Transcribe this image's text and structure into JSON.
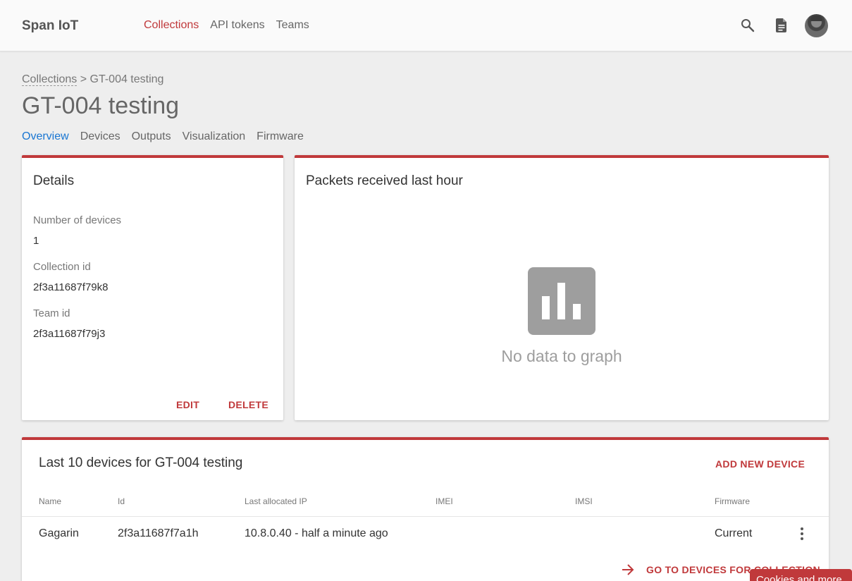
{
  "header": {
    "brand": "Span IoT",
    "nav": [
      {
        "label": "Collections",
        "active": true
      },
      {
        "label": "API tokens",
        "active": false
      },
      {
        "label": "Teams",
        "active": false
      }
    ],
    "icons": [
      "search-icon",
      "document-icon",
      "avatar"
    ]
  },
  "breadcrumb": {
    "link": "Collections",
    "separator": " > ",
    "current": "GT-004 testing"
  },
  "page": {
    "title": "GT-004 testing",
    "tabs": [
      {
        "label": "Overview",
        "active": true
      },
      {
        "label": "Devices",
        "active": false
      },
      {
        "label": "Outputs",
        "active": false
      },
      {
        "label": "Visualization",
        "active": false
      },
      {
        "label": "Firmware",
        "active": false
      }
    ]
  },
  "details": {
    "title": "Details",
    "fields": [
      {
        "label": "Number of devices",
        "value": "1"
      },
      {
        "label": "Collection id",
        "value": "2f3a11687f79k8"
      },
      {
        "label": "Team id",
        "value": "2f3a11687f79j3"
      }
    ],
    "edit_label": "EDIT",
    "delete_label": "DELETE"
  },
  "packets": {
    "title": "Packets received last hour",
    "empty_text": "No data to graph",
    "icon": "bar-chart-icon"
  },
  "devices": {
    "title": "Last 10 devices for GT-004 testing",
    "add_label": "ADD NEW DEVICE",
    "columns": [
      "Name",
      "Id",
      "Last allocated IP",
      "IMEI",
      "IMSI",
      "Firmware"
    ],
    "rows": [
      {
        "name": "Gagarin",
        "id": "2f3a11687f7a1h",
        "ip": "10.8.0.40 - half a minute ago",
        "imei": "",
        "imsi": "",
        "firmware": "Current"
      }
    ],
    "goto_label": "GO TO DEVICES FOR COLLECTION"
  },
  "cookie": {
    "label": "Cookies and more"
  },
  "colors": {
    "accent": "#c0393b",
    "active_tab": "#1976d2",
    "muted_icon": "#9e9e9e"
  }
}
